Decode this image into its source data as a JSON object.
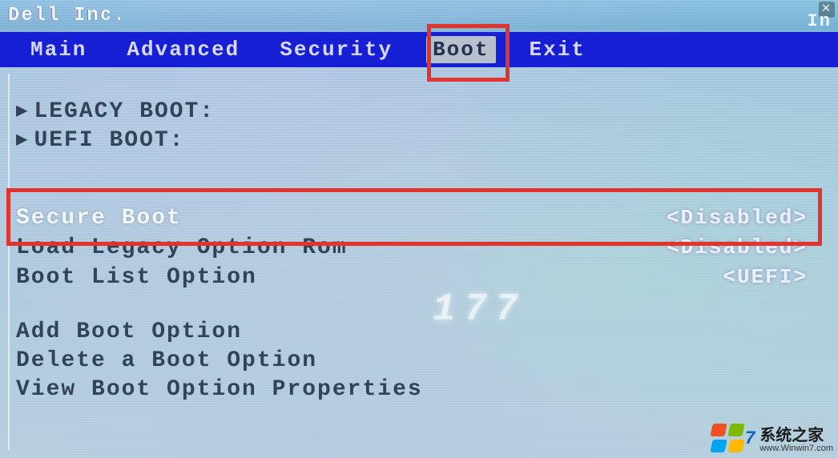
{
  "vendor": "Dell Inc.",
  "top_right": "In",
  "menu": {
    "items": [
      "Main",
      "Advanced",
      "Security",
      "Boot",
      "Exit"
    ],
    "selected_index": 3
  },
  "sections": {
    "legacy": "LEGACY BOOT:",
    "uefi": "UEFI BOOT:"
  },
  "options": [
    {
      "label": "Secure Boot",
      "value": "<Disabled>"
    },
    {
      "label": "Load Legacy Option Rom",
      "value": "<Disabled>"
    },
    {
      "label": "Boot List Option",
      "value": "<UEFI>"
    }
  ],
  "actions": [
    "Add Boot Option",
    "Delete a Boot Option",
    "View Boot Option Properties"
  ],
  "artifact_text": "177",
  "watermark": {
    "brand": "系统之家",
    "url": "www.Winwin7.com",
    "seven": "7"
  },
  "close_glyph": "✕"
}
